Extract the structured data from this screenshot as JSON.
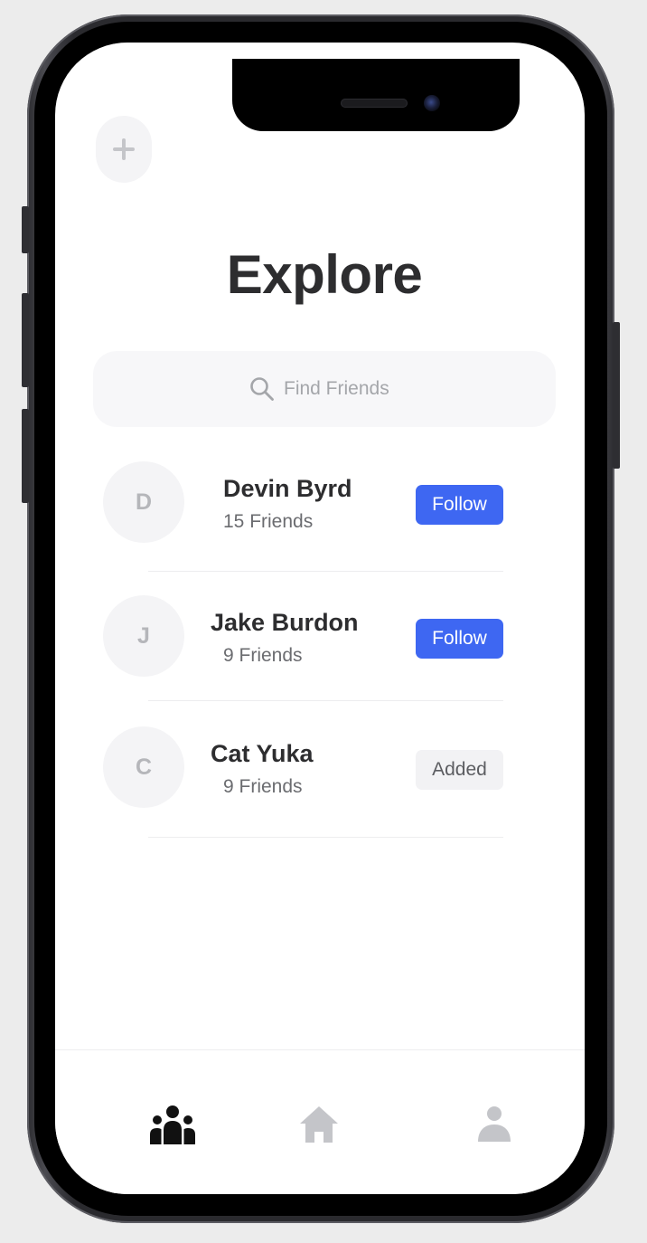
{
  "screen": {
    "add_button_label": "+",
    "title": "Explore"
  },
  "search": {
    "placeholder": "Find Friends",
    "icon": "search-icon"
  },
  "friends": [
    {
      "initial": "D",
      "name": "Devin Byrd",
      "friends_count": "15 Friends",
      "action_label": "Follow",
      "action_state": "follow"
    },
    {
      "initial": "J",
      "name": "Jake Burdon",
      "friends_count": "9 Friends",
      "action_label": "Follow",
      "action_state": "follow"
    },
    {
      "initial": "C",
      "name": "Cat Yuka",
      "friends_count": "9 Friends",
      "action_label": "Added",
      "action_state": "added"
    }
  ],
  "tab_bar": {
    "items": [
      {
        "icon": "friends-icon",
        "active": true
      },
      {
        "icon": "home-icon",
        "active": false
      },
      {
        "icon": "profile-icon",
        "active": false
      }
    ]
  },
  "colors": {
    "accent": "#3e67f2",
    "title_text": "#2d2d2f",
    "muted_icon": "#c4c5c9",
    "active_icon": "#111111"
  }
}
